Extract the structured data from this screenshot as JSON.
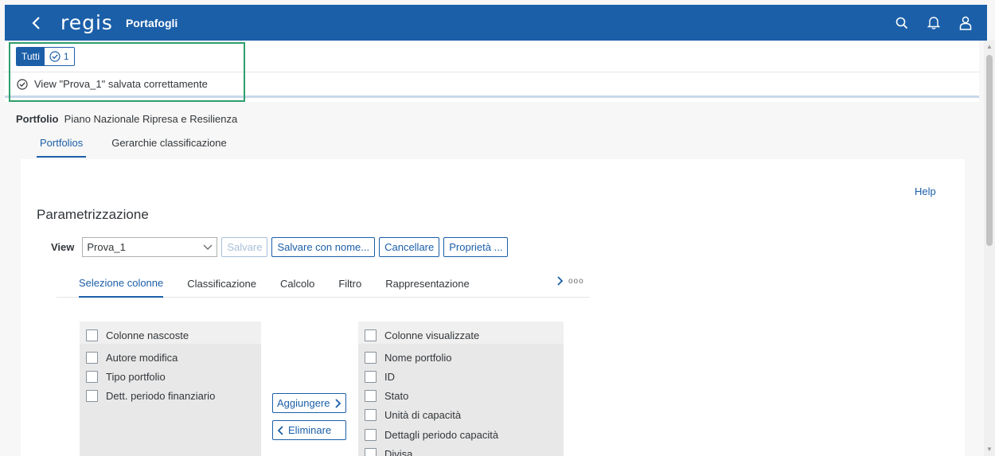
{
  "shell": {
    "logo": "regis",
    "title": "Portafogli"
  },
  "messages": {
    "filter_all": "Tutti",
    "success_count": "1",
    "message_text": "View \"Prova_1\" salvata correttamente"
  },
  "object": {
    "label": "Portfolio",
    "name": "Piano Nazionale Ripresa e Resilienza",
    "tabs": [
      {
        "label": "Portfolios",
        "active": true
      },
      {
        "label": "Gerarchie classificazione",
        "active": false
      }
    ]
  },
  "content": {
    "help": "Help",
    "section_title": "Parametrizzazione",
    "view": {
      "label": "View",
      "selected": "Prova_1",
      "save": "Salvare",
      "save_as": "Salvare con nome...",
      "delete": "Cancellare",
      "properties": "Proprietà ..."
    },
    "sub_tabs": [
      {
        "label": "Selezione colonne",
        "active": true
      },
      {
        "label": "Classificazione",
        "active": false
      },
      {
        "label": "Calcolo",
        "active": false
      },
      {
        "label": "Filtro",
        "active": false
      },
      {
        "label": "Rappresentazione",
        "active": false
      }
    ],
    "more_dots": "ooo",
    "hidden_columns": {
      "header": "Colonne nascoste",
      "items": [
        "Autore modifica",
        "Tipo portfolio",
        "Dett. periodo finanziario"
      ]
    },
    "visible_columns": {
      "header": "Colonne visualizzate",
      "items": [
        "Nome portfolio",
        "ID",
        "Stato",
        "Unità di capacità",
        "Dettagli periodo capacità",
        "Divisa"
      ]
    },
    "add_button": "Aggiungere",
    "remove_button": "Eliminare"
  },
  "colors": {
    "shell_bg": "#1b5fa8",
    "accent": "#1b5fa8",
    "success": "#2e9e6b"
  }
}
